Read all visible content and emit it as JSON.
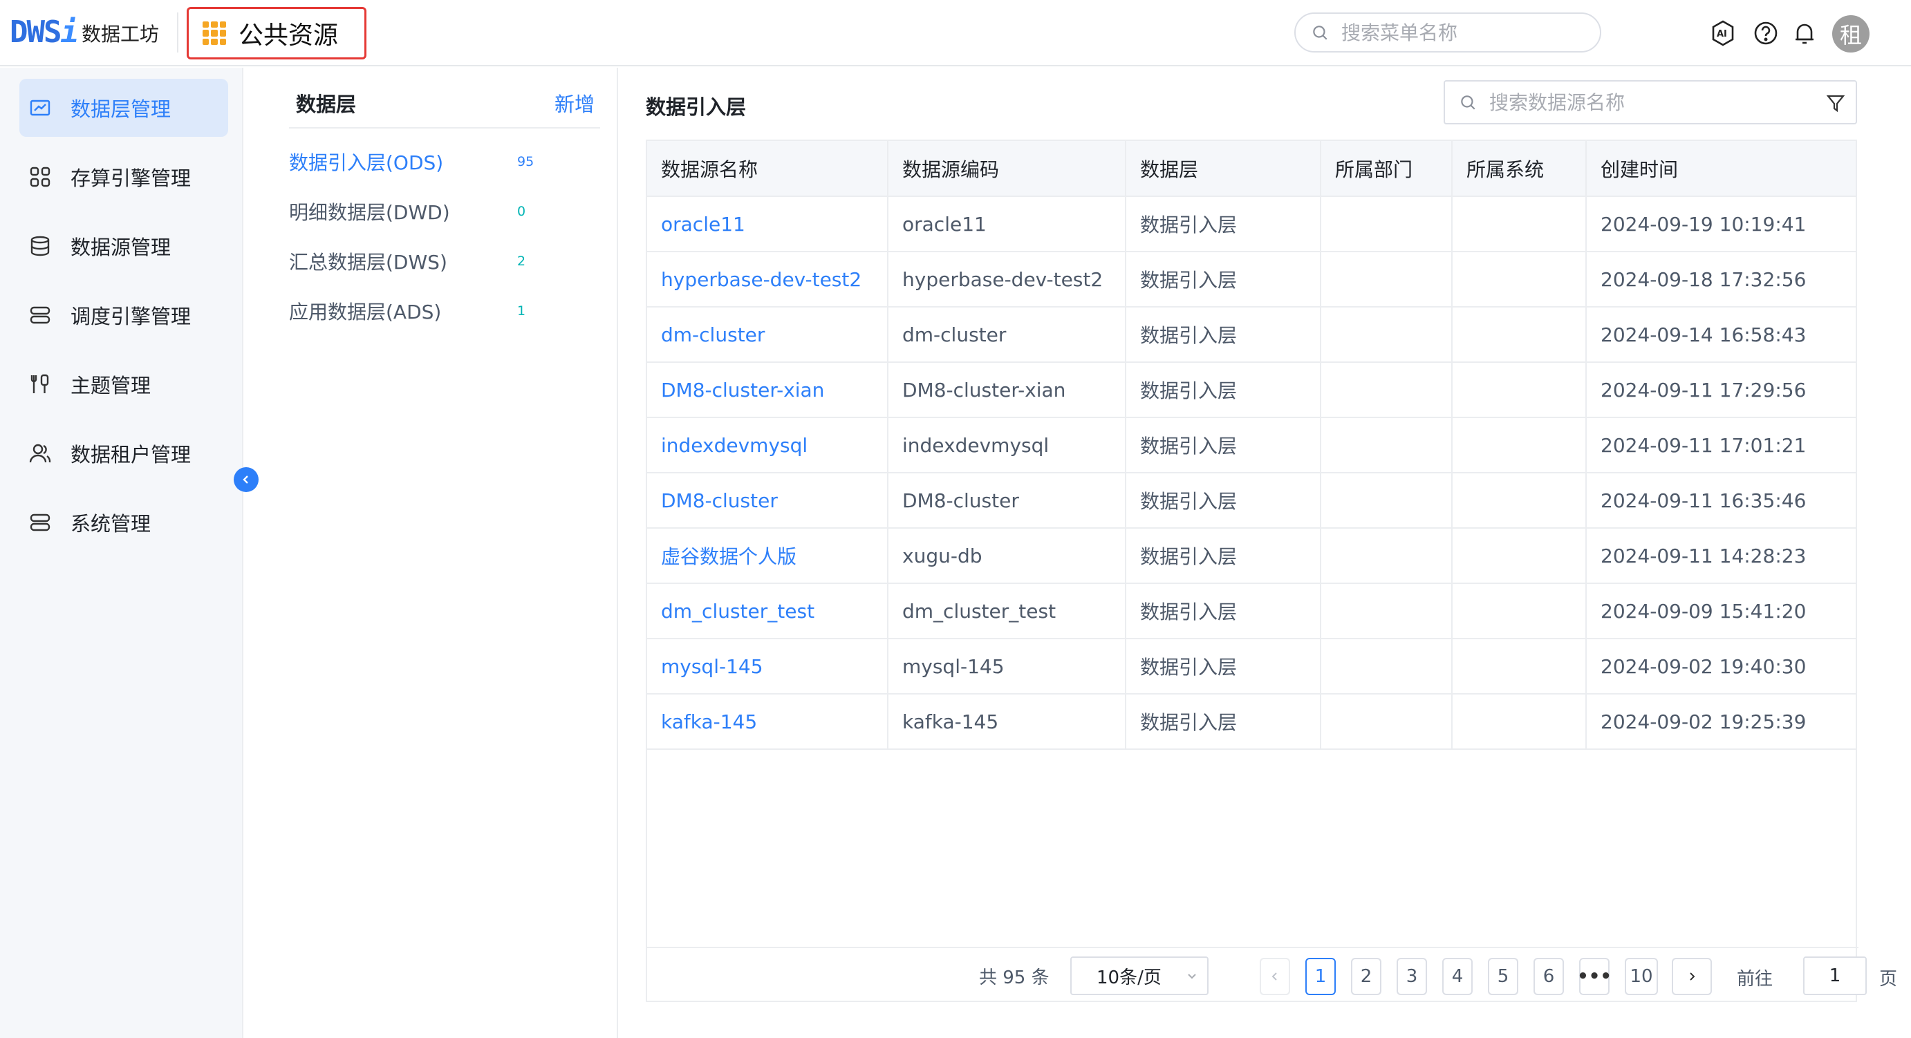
{
  "header": {
    "logo_mark": "DWS",
    "logo_mark_i": "i",
    "logo_text": "数据工坊",
    "public_resources": "公共资源",
    "menu_search_placeholder": "搜索菜单名称",
    "avatar_text": "租"
  },
  "sidebar": {
    "items": [
      {
        "label": "数据层管理",
        "icon": "data-layer-icon",
        "active": true
      },
      {
        "label": "存算引擎管理",
        "icon": "grid-apps-icon",
        "active": false
      },
      {
        "label": "数据源管理",
        "icon": "database-icon",
        "active": false
      },
      {
        "label": "调度引擎管理",
        "icon": "server-icon",
        "active": false
      },
      {
        "label": "主题管理",
        "icon": "tools-icon",
        "active": false
      },
      {
        "label": "数据租户管理",
        "icon": "users-icon",
        "active": false
      },
      {
        "label": "系统管理",
        "icon": "server-icon",
        "active": false
      }
    ]
  },
  "layer_panel": {
    "title": "数据层",
    "add_label": "新增",
    "layers": [
      {
        "name": "数据引入层(ODS)",
        "count": "95",
        "active": true
      },
      {
        "name": "明细数据层(DWD)",
        "count": "0",
        "active": false
      },
      {
        "name": "汇总数据层(DWS)",
        "count": "2",
        "active": false
      },
      {
        "name": "应用数据层(ADS)",
        "count": "1",
        "active": false
      }
    ]
  },
  "main": {
    "title": "数据引入层",
    "search_placeholder": "搜索数据源名称",
    "columns": [
      "数据源名称",
      "数据源编码",
      "数据层",
      "所属部门",
      "所属系统",
      "创建时间"
    ],
    "rows": [
      [
        "oracle11",
        "oracle11",
        "数据引入层",
        "",
        "",
        "2024-09-19 10:19:41"
      ],
      [
        "hyperbase-dev-test2",
        "hyperbase-dev-test2",
        "数据引入层",
        "",
        "",
        "2024-09-18 17:32:56"
      ],
      [
        "dm-cluster",
        "dm-cluster",
        "数据引入层",
        "",
        "",
        "2024-09-14 16:58:43"
      ],
      [
        "DM8-cluster-xian",
        "DM8-cluster-xian",
        "数据引入层",
        "",
        "",
        "2024-09-11 17:29:56"
      ],
      [
        "indexdevmysql",
        "indexdevmysql",
        "数据引入层",
        "",
        "",
        "2024-09-11 17:01:21"
      ],
      [
        "DM8-cluster",
        "DM8-cluster",
        "数据引入层",
        "",
        "",
        "2024-09-11 16:35:46"
      ],
      [
        "虚谷数据个人版",
        "xugu-db",
        "数据引入层",
        "",
        "",
        "2024-09-11 14:28:23"
      ],
      [
        "dm_cluster_test",
        "dm_cluster_test",
        "数据引入层",
        "",
        "",
        "2024-09-09 15:41:20"
      ],
      [
        "mysql-145",
        "mysql-145",
        "数据引入层",
        "",
        "",
        "2024-09-02 19:40:30"
      ],
      [
        "kafka-145",
        "kafka-145",
        "数据引入层",
        "",
        "",
        "2024-09-02 19:25:39"
      ]
    ]
  },
  "pagination": {
    "total_text": "共 95 条",
    "page_size": "10条/页",
    "pages": [
      "1",
      "2",
      "3",
      "4",
      "5",
      "6",
      "•••",
      "10"
    ],
    "current_page": "1",
    "goto_label": "前往",
    "goto_value": "1",
    "page_suffix": "页"
  },
  "colors": {
    "accent": "#2d7ff9",
    "highlight_border": "#e53935",
    "grid_icon": "#f5a623"
  }
}
